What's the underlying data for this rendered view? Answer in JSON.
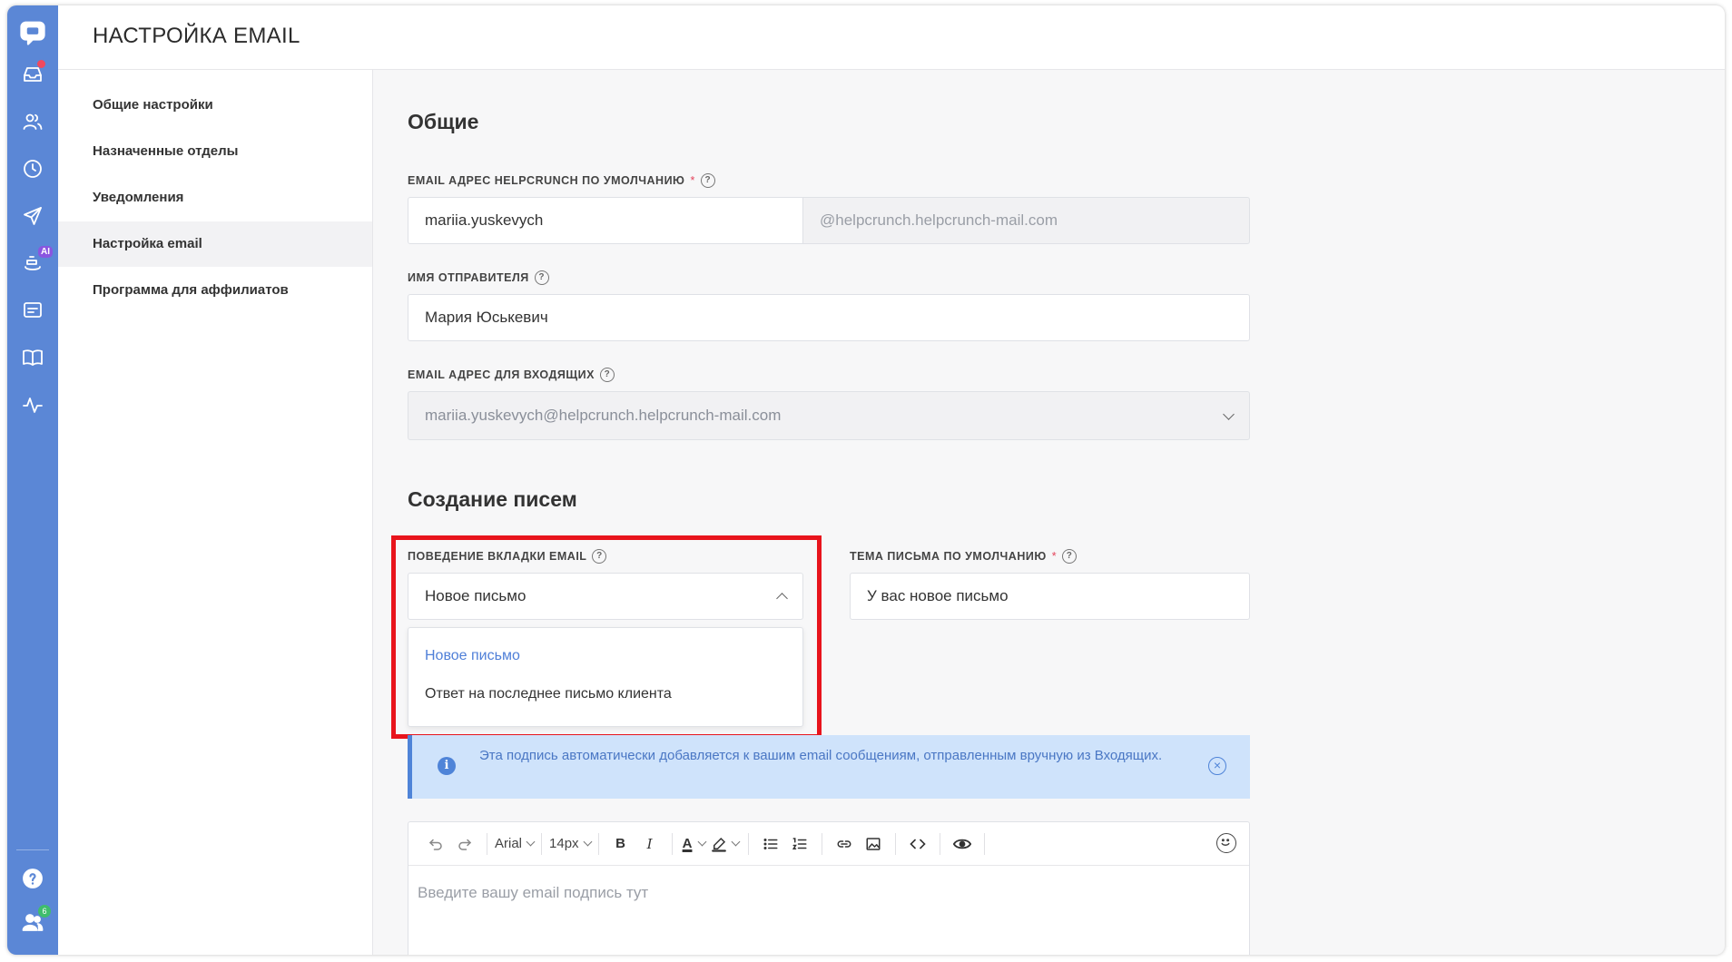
{
  "header": {
    "title": "НАСТРОЙКА EMAIL"
  },
  "rail": {
    "icons": [
      "chat-logo-icon",
      "inbox-icon",
      "contacts-icon",
      "history-icon",
      "send-icon",
      "ai-bot-icon",
      "widget-icon",
      "knowledge-base-icon",
      "activity-icon",
      "help-icon",
      "team-icon"
    ],
    "ai_badge": "AI",
    "team_badge": "6"
  },
  "sidebar": {
    "items": [
      {
        "label": "Общие настройки",
        "active": false
      },
      {
        "label": "Назначенные отделы",
        "active": false
      },
      {
        "label": "Уведомления",
        "active": false
      },
      {
        "label": "Настройка email",
        "active": true
      },
      {
        "label": "Программа для аффилиатов",
        "active": false
      }
    ]
  },
  "general": {
    "heading": "Общие",
    "default_email_label": "EMAIL АДРЕС HELPCRUNCH ПО УМОЛЧАНИЮ",
    "default_email_value": "mariia.yuskevych",
    "default_email_suffix": "@helpcrunch.helpcrunch-mail.com",
    "sender_name_label": "ИМЯ ОТПРАВИТЕЛЯ",
    "sender_name_value": "Мария Юськевич",
    "incoming_label": "EMAIL АДРЕС ДЛЯ ВХОДЯЩИХ",
    "incoming_value": "mariia.yuskevych@helpcrunch.helpcrunch-mail.com"
  },
  "compose": {
    "heading": "Создание писем",
    "behavior_label": "ПОВЕДЕНИЕ ВКЛАДКИ EMAIL",
    "behavior_value": "Новое письмо",
    "behavior_options": [
      "Новое письмо",
      "Ответ на последнее письмо клиента"
    ],
    "subject_label": "ТЕМА ПИСЬМА ПО УМОЛЧАНИЮ",
    "subject_value": "У вас новое письмо",
    "required_mark": "*",
    "help_mark": "?"
  },
  "info": {
    "text": "Эта подпись автоматически добавляется к вашим email сообщениям, отправленным вручную из Входящих.",
    "icon_glyph": "i",
    "close_glyph": "×"
  },
  "editor": {
    "font": "Arial",
    "size": "14px",
    "bold": "B",
    "italic": "I",
    "text_color": "A",
    "placeholder": "Введите вашу email подпись тут"
  },
  "colors": {
    "rail": "#5b87d6",
    "accent": "#4f7fd8",
    "highlight": "#e8141c",
    "info_bg": "#cfe3fb"
  }
}
